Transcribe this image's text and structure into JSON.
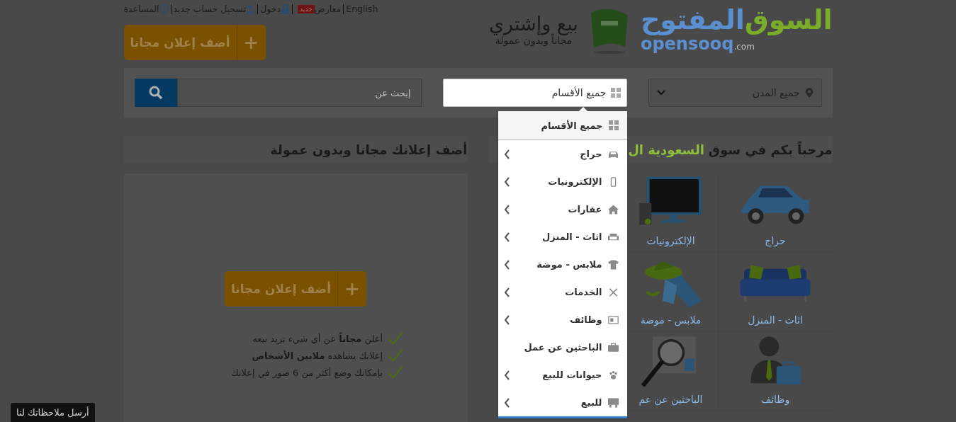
{
  "top_links": [
    {
      "label": "English"
    },
    {
      "label": "معارض",
      "badge": "جديد"
    },
    {
      "label": "دخول"
    },
    {
      "label": "تسجيل حساب جديد"
    },
    {
      "label": "المساعدة"
    }
  ],
  "post_ad_button": {
    "label": "أضف إعلان مجانا",
    "icon_text": "+"
  },
  "logo": {
    "name_parts": [
      "السوق",
      "المفتوح"
    ],
    "latin": "opensooq",
    "domain": ".com"
  },
  "tagline": {
    "title": "بيع وإشتري",
    "subtitle": "مجاناً وبدون عمولة"
  },
  "search_bar": {
    "city": "جميع المدن",
    "category": "جميع الأقسام",
    "placeholder": "إبحث عن"
  },
  "category_menu": {
    "header": "جميع الأقسام",
    "items": [
      {
        "label": "حراج",
        "submenu": true
      },
      {
        "label": "الإلكترونيات",
        "submenu": true
      },
      {
        "label": "عقارات",
        "submenu": true
      },
      {
        "label": "اثاث - المنزل",
        "submenu": true
      },
      {
        "label": "ملابس - موضة",
        "submenu": true
      },
      {
        "label": "الخدمات",
        "submenu": true
      },
      {
        "label": "وظائف",
        "submenu": true
      },
      {
        "label": "الباحثين عن عمل",
        "submenu": false
      },
      {
        "label": "حيوانات للبيع",
        "submenu": true
      },
      {
        "label": "للبيع",
        "submenu": true
      }
    ]
  },
  "welcome": {
    "text": "مرحباً بكم في سوق",
    "highlight": "السعودية ال"
  },
  "category_grid": [
    {
      "label": "حراج"
    },
    {
      "label": "الإلكترونيات"
    },
    {
      "label": "اثاث - المنزل"
    },
    {
      "label": "ملابس - موضة"
    },
    {
      "label": "وظائف"
    },
    {
      "label": "الباحثين عن عم"
    }
  ],
  "free_ad_panel": {
    "title": "أضف إعلانك مجانا وبدون عمولة",
    "button": {
      "label": "أضف إعلان مجانا",
      "icon_text": "+"
    },
    "benefits": [
      "أعلن **مجاناً** عن أي شيء تريد بيعه",
      "إعلانك يشاهده **ملايين الأشخاص**",
      "بإمكانك وضع أكثر من 6 صور في إعلانك"
    ]
  },
  "feedback_tab": {
    "label": "أرسل ملاحظاتك لنا"
  }
}
